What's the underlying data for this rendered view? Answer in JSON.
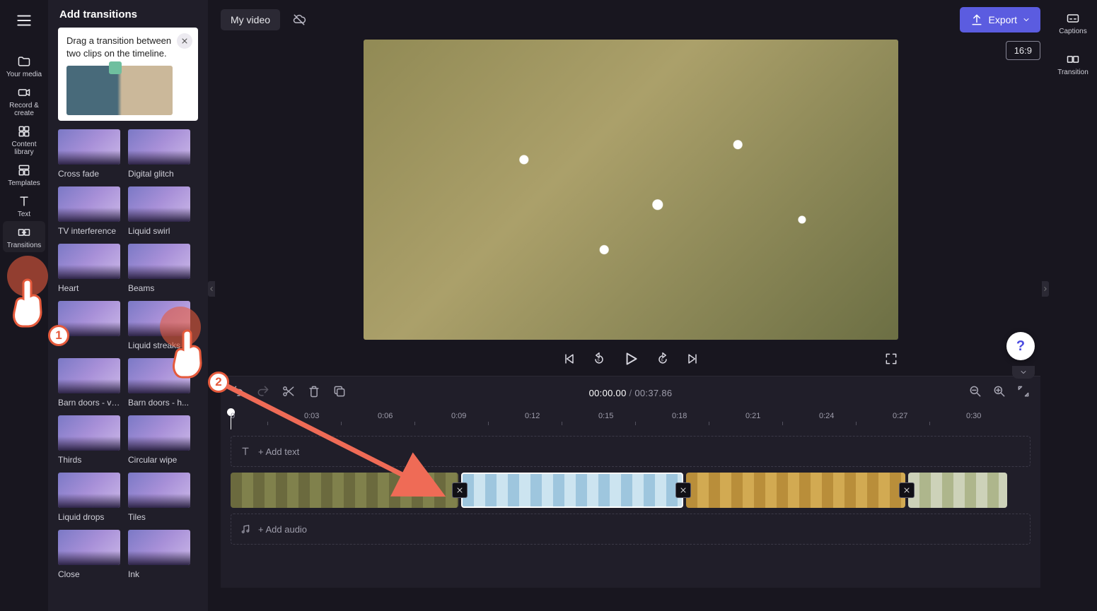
{
  "left_rail": {
    "items": [
      {
        "label": "Your media"
      },
      {
        "label": "Record & create"
      },
      {
        "label": "Content library"
      },
      {
        "label": "Templates"
      },
      {
        "label": "Text"
      },
      {
        "label": "Transitions"
      }
    ]
  },
  "panel": {
    "title": "Add transitions",
    "hint": "Drag a transition between two clips on the timeline.",
    "transitions": [
      {
        "label": "Cross fade"
      },
      {
        "label": "Digital glitch"
      },
      {
        "label": "TV interference"
      },
      {
        "label": "Liquid swirl"
      },
      {
        "label": "Heart"
      },
      {
        "label": "Beams"
      },
      {
        "label": ""
      },
      {
        "label": "Liquid streaks"
      },
      {
        "label": "Barn doors - ve..."
      },
      {
        "label": "Barn doors - h..."
      },
      {
        "label": "Thirds"
      },
      {
        "label": "Circular wipe"
      },
      {
        "label": "Liquid drops"
      },
      {
        "label": "Tiles"
      },
      {
        "label": "Close"
      },
      {
        "label": "Ink"
      }
    ]
  },
  "header": {
    "video_title": "My video",
    "export_label": "Export",
    "aspect_ratio": "16:9"
  },
  "right_rail": {
    "items": [
      {
        "label": "Captions"
      },
      {
        "label": "Transition"
      }
    ]
  },
  "timeline": {
    "current": "00:00.00",
    "separator": " / ",
    "total": "00:37.86",
    "add_text_label": "+ Add text",
    "add_audio_label": "+ Add audio",
    "ruler": [
      "0",
      "0:03",
      "0:06",
      "0:09",
      "0:12",
      "0:15",
      "0:18",
      "0:21",
      "0:24",
      "0:27",
      "0:30"
    ],
    "ruler_spacing": 104
  },
  "help": {
    "glyph": "?"
  },
  "annotations": {
    "badge1": "1",
    "badge2": "2"
  }
}
